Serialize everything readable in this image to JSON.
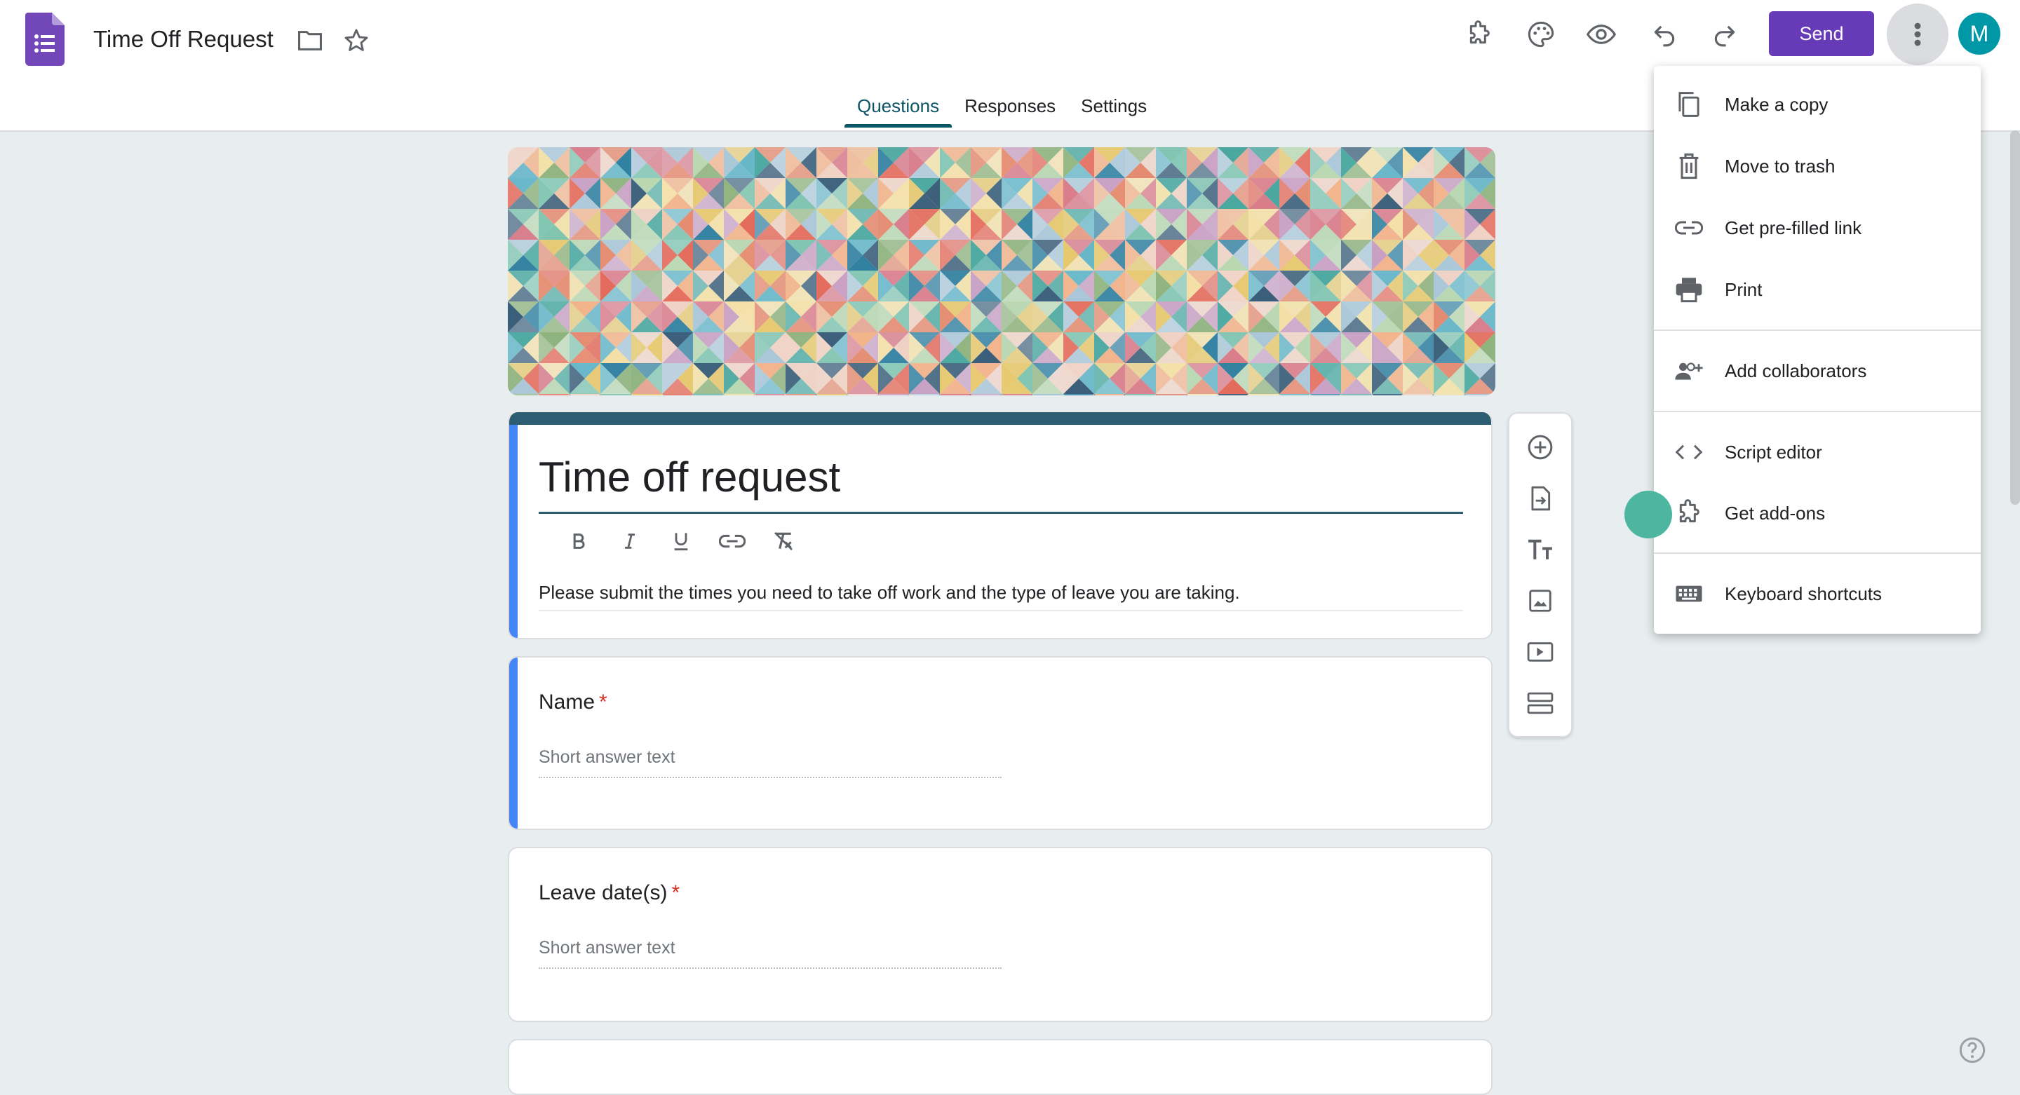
{
  "header": {
    "doc_title": "Time Off Request",
    "send_label": "Send",
    "avatar_initial": "M",
    "icons": [
      "forms-logo-icon",
      "folder-icon",
      "star-icon",
      "addons-puzzle-icon",
      "palette-icon",
      "preview-eye-icon",
      "undo-icon",
      "redo-icon",
      "more-vert-icon"
    ]
  },
  "tabs": [
    {
      "label": "Questions",
      "active": true
    },
    {
      "label": "Responses",
      "active": false
    },
    {
      "label": "Settings",
      "active": false
    }
  ],
  "form": {
    "title": "Time off request",
    "description": "Please submit the times you need to take off work and the type of leave you are taking.",
    "format_tools": [
      "bold-icon",
      "italic-icon",
      "underline-icon",
      "link-icon",
      "clear-format-icon"
    ]
  },
  "questions": [
    {
      "label": "Name",
      "required_mark": "*",
      "placeholder": "Short answer text"
    },
    {
      "label": "Leave date(s)",
      "required_mark": "*",
      "placeholder": "Short answer text"
    }
  ],
  "side_toolbar": [
    "add-question-icon",
    "import-questions-icon",
    "add-title-icon",
    "add-image-icon",
    "add-video-icon",
    "add-section-icon"
  ],
  "menu": {
    "items": [
      {
        "label": "Make a copy",
        "icon": "copy-icon"
      },
      {
        "label": "Move to trash",
        "icon": "trash-icon"
      },
      {
        "label": "Get pre-filled link",
        "icon": "link-icon"
      },
      {
        "label": "Print",
        "icon": "print-icon"
      },
      {
        "label": "Add collaborators",
        "icon": "add-people-icon"
      },
      {
        "label": "Script editor",
        "icon": "code-icon"
      },
      {
        "label": "Get add-ons",
        "icon": "addons-puzzle-icon"
      },
      {
        "label": "Keyboard shortcuts",
        "icon": "keyboard-icon"
      }
    ]
  },
  "colors": {
    "accent": "#673ab7",
    "theme": "#0b5566",
    "background": "#e8edef",
    "required": "#d93025",
    "avatar": "#0098a6"
  }
}
